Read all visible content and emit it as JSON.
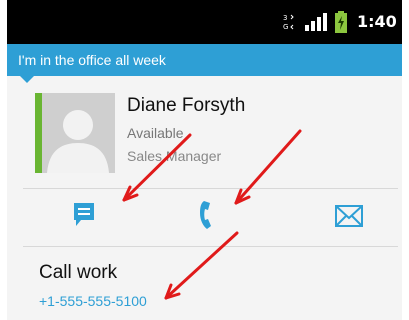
{
  "status_bar": {
    "time": "1:40",
    "network": "3G"
  },
  "status_message": "I'm in the office all week",
  "contact": {
    "name": "Diane Forsyth",
    "presence": "Available",
    "title": "Sales Manager"
  },
  "actions": [
    {
      "name": "message",
      "icon": "chat-bubble-icon"
    },
    {
      "name": "call",
      "icon": "phone-icon"
    },
    {
      "name": "email",
      "icon": "envelope-icon"
    }
  ],
  "call_entry": {
    "label": "Call work",
    "number": "+1-555-555-5100"
  },
  "colors": {
    "accent": "#2e9fd5",
    "presence": "#69b532",
    "annotation": "#e01a1a"
  }
}
